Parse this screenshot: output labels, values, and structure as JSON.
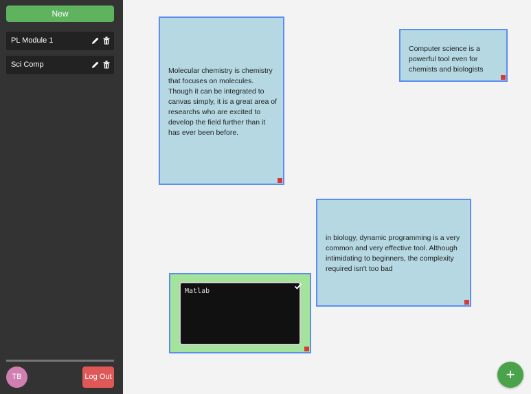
{
  "sidebar": {
    "new_button_label": "New",
    "modules": [
      {
        "label": "PL Module 1",
        "edit_icon": "pencil-icon",
        "delete_icon": "trash-icon"
      },
      {
        "label": "Sci Comp",
        "edit_icon": "pencil-icon",
        "delete_icon": "trash-icon"
      }
    ],
    "avatar_initials": "TB",
    "logout_label": "Log Out"
  },
  "notes": [
    {
      "text": "Molecular chemistry is chemistry that focuses on molecules. Though it can be integrated to canvas simply, it is a great area of researchs who are excited to develop the field further than it has ever been before."
    },
    {
      "text": "Computer science is a powerful tool even for chemists and biologists"
    },
    {
      "text": "in biology, dynamic programming is a very common and very effective tool. Although intimidating to beginners, the complexity required isn't too bad"
    }
  ],
  "editing_note": {
    "value": "Matlab",
    "confirm_icon": "check-icon"
  },
  "fab": {
    "label": "+",
    "icon": "plus-icon"
  },
  "colors": {
    "sidebar_bg": "#333333",
    "new_button": "#5fb35f",
    "logout_button": "#e05757",
    "avatar": "#d17fb0",
    "note_bg": "#b5d8e3",
    "note_border": "#5b8ef0",
    "editing_note_bg": "#a3e39c",
    "resize_handle": "#d43a3a",
    "fab": "#4aa34a"
  }
}
